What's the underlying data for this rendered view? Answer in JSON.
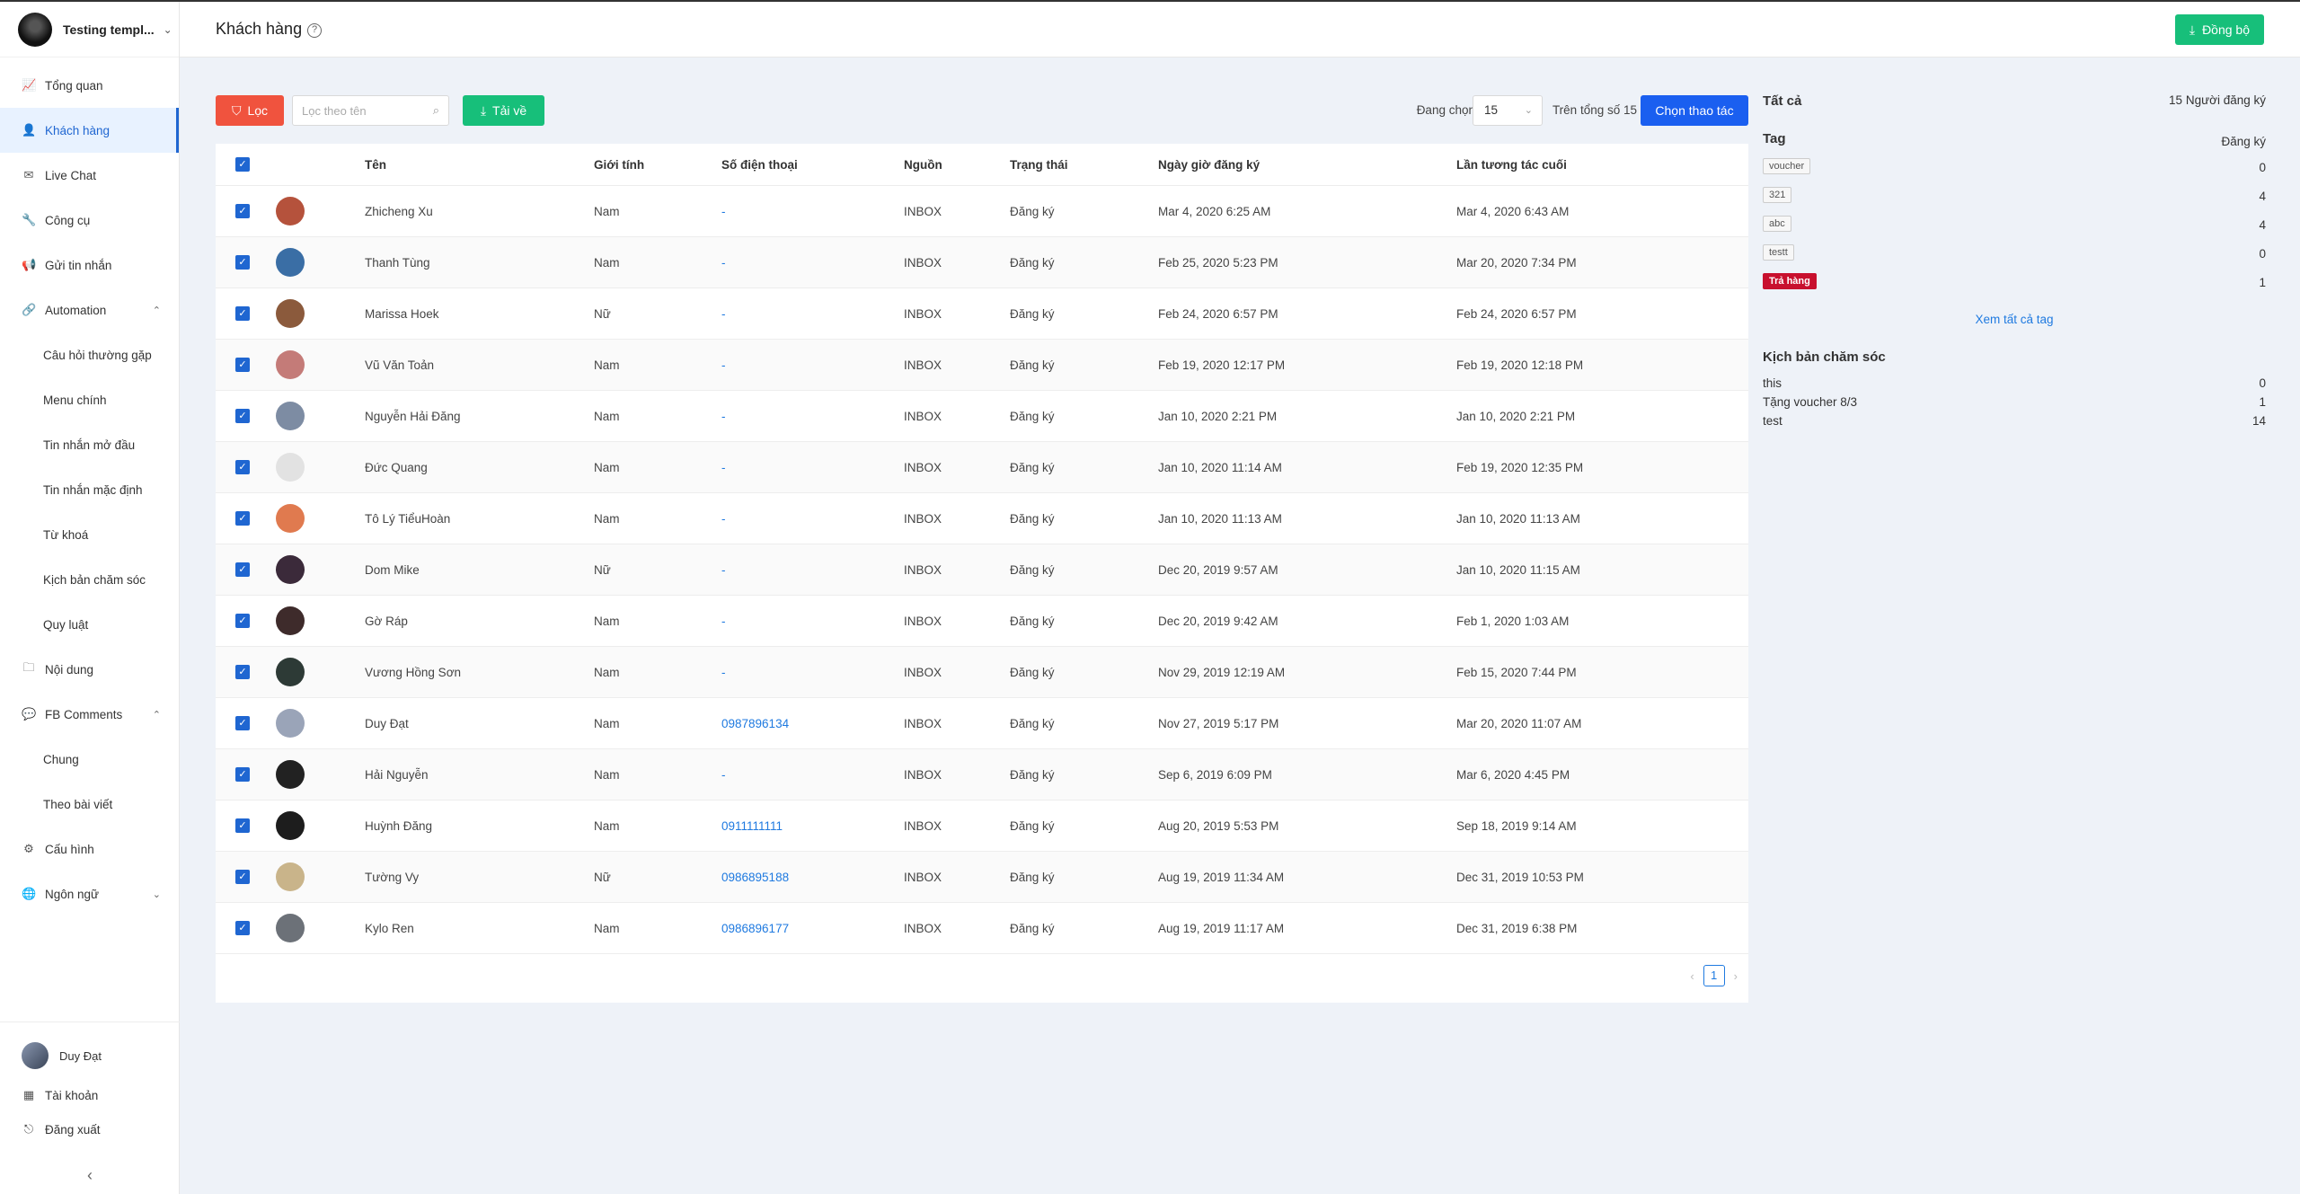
{
  "brand": {
    "name": "Testing templ..."
  },
  "sidebar": {
    "items": [
      {
        "label": "Tổng quan",
        "icon": "chart-icon",
        "glyph": "📈",
        "sub": false,
        "active": false
      },
      {
        "label": "Khách hàng",
        "icon": "user-icon",
        "glyph": "👤",
        "sub": false,
        "active": true
      },
      {
        "label": "Live Chat",
        "icon": "mail-icon",
        "glyph": "✉",
        "sub": false,
        "active": false
      },
      {
        "label": "Công cụ",
        "icon": "tool-icon",
        "glyph": "🔧",
        "sub": false,
        "active": false
      },
      {
        "label": "Gửi tin nhắn",
        "icon": "megaphone-icon",
        "glyph": "📢",
        "sub": false,
        "active": false
      },
      {
        "label": "Automation",
        "icon": "link-icon",
        "glyph": "🔗",
        "sub": false,
        "active": false,
        "arrow": "⌃"
      },
      {
        "label": "Câu hỏi thường gặp",
        "sub": true
      },
      {
        "label": "Menu chính",
        "sub": true
      },
      {
        "label": "Tin nhắn mở đầu",
        "sub": true
      },
      {
        "label": "Tin nhắn mặc định",
        "sub": true
      },
      {
        "label": "Từ khoá",
        "sub": true
      },
      {
        "label": "Kịch bản chăm sóc",
        "sub": true
      },
      {
        "label": "Quy luật",
        "sub": true
      },
      {
        "label": "Nội dung",
        "icon": "folder-icon",
        "glyph": "🗀",
        "sub": false
      },
      {
        "label": "FB Comments",
        "icon": "comment-icon",
        "glyph": "💬",
        "sub": false,
        "arrow": "⌃"
      },
      {
        "label": "Chung",
        "sub": true
      },
      {
        "label": "Theo bài viết",
        "sub": true
      },
      {
        "label": "Cấu hình",
        "icon": "gear-icon",
        "glyph": "⚙",
        "sub": false
      },
      {
        "label": "Ngôn ngữ",
        "icon": "globe-icon",
        "glyph": "🌐",
        "sub": false,
        "arrow": "⌄"
      }
    ],
    "user": "Duy Đạt",
    "account": "Tài khoản",
    "logout": "Đăng xuất"
  },
  "header": {
    "title": "Khách hàng",
    "sync": "Đồng bộ"
  },
  "toolbar": {
    "filter": "Lọc",
    "search_placeholder": "Lọc theo tên",
    "download": "Tải về",
    "selecting_label": "Đang chọn",
    "selecting_value": "15",
    "total_label": "Trên tổng số 15",
    "action": "Chọn thao tác"
  },
  "table": {
    "columns": [
      "Tên",
      "Giới tính",
      "Số điện thoại",
      "Nguồn",
      "Trạng thái",
      "Ngày giờ đăng ký",
      "Lần tương tác cuối"
    ],
    "rows": [
      {
        "name": "Zhicheng Xu",
        "gender": "Nam",
        "phone": "-",
        "source": "INBOX",
        "status": "Đăng ký",
        "registered": "Mar 4, 2020 6:25 AM",
        "last": "Mar 4, 2020 6:43 AM",
        "avatar": "#b5523c"
      },
      {
        "name": "Thanh Tùng",
        "gender": "Nam",
        "phone": "-",
        "source": "INBOX",
        "status": "Đăng ký",
        "registered": "Feb 25, 2020 5:23 PM",
        "last": "Mar 20, 2020 7:34 PM",
        "avatar": "#3a6ea5"
      },
      {
        "name": "Marissa Hoek",
        "gender": "Nữ",
        "phone": "-",
        "source": "INBOX",
        "status": "Đăng ký",
        "registered": "Feb 24, 2020 6:57 PM",
        "last": "Feb 24, 2020 6:57 PM",
        "avatar": "#8b5a3c"
      },
      {
        "name": "Vũ Văn Toản",
        "gender": "Nam",
        "phone": "-",
        "source": "INBOX",
        "status": "Đăng ký",
        "registered": "Feb 19, 2020 12:17 PM",
        "last": "Feb 19, 2020 12:18 PM",
        "avatar": "#c47b78"
      },
      {
        "name": "Nguyễn Hải Đăng",
        "gender": "Nam",
        "phone": "-",
        "source": "INBOX",
        "status": "Đăng ký",
        "registered": "Jan 10, 2020 2:21 PM",
        "last": "Jan 10, 2020 2:21 PM",
        "avatar": "#7d8ca3"
      },
      {
        "name": "Đức Quang",
        "gender": "Nam",
        "phone": "-",
        "source": "INBOX",
        "status": "Đăng ký",
        "registered": "Jan 10, 2020 11:14 AM",
        "last": "Feb 19, 2020 12:35 PM",
        "avatar": "#e2e2e2"
      },
      {
        "name": "Tô Lý TiểuHoàn",
        "gender": "Nam",
        "phone": "-",
        "source": "INBOX",
        "status": "Đăng ký",
        "registered": "Jan 10, 2020 11:13 AM",
        "last": "Jan 10, 2020 11:13 AM",
        "avatar": "#e07a4f"
      },
      {
        "name": "Dom Mike",
        "gender": "Nữ",
        "phone": "-",
        "source": "INBOX",
        "status": "Đăng ký",
        "registered": "Dec 20, 2019 9:57 AM",
        "last": "Jan 10, 2020 11:15 AM",
        "avatar": "#3b2a3a"
      },
      {
        "name": "Gờ Ráp",
        "gender": "Nam",
        "phone": "-",
        "source": "INBOX",
        "status": "Đăng ký",
        "registered": "Dec 20, 2019 9:42 AM",
        "last": "Feb 1, 2020 1:03 AM",
        "avatar": "#3e2b2b"
      },
      {
        "name": "Vương Hồng Sơn",
        "gender": "Nam",
        "phone": "-",
        "source": "INBOX",
        "status": "Đăng ký",
        "registered": "Nov 29, 2019 12:19 AM",
        "last": "Feb 15, 2020 7:44 PM",
        "avatar": "#2d3a36"
      },
      {
        "name": "Duy Đạt",
        "gender": "Nam",
        "phone": "0987896134",
        "source": "INBOX",
        "status": "Đăng ký",
        "registered": "Nov 27, 2019 5:17 PM",
        "last": "Mar 20, 2020 11:07 AM",
        "avatar": "#9aa4b8"
      },
      {
        "name": "Hải Nguyễn",
        "gender": "Nam",
        "phone": "-",
        "source": "INBOX",
        "status": "Đăng ký",
        "registered": "Sep 6, 2019 6:09 PM",
        "last": "Mar 6, 2020 4:45 PM",
        "avatar": "#222222"
      },
      {
        "name": "Huỳnh Đăng",
        "gender": "Nam",
        "phone": "0911111111",
        "source": "INBOX",
        "status": "Đăng ký",
        "registered": "Aug 20, 2019 5:53 PM",
        "last": "Sep 18, 2019 9:14 AM",
        "avatar": "#1d1d1d"
      },
      {
        "name": "Tường Vy",
        "gender": "Nữ",
        "phone": "0986895188",
        "source": "INBOX",
        "status": "Đăng ký",
        "registered": "Aug 19, 2019 11:34 AM",
        "last": "Dec 31, 2019 10:53 PM",
        "avatar": "#c9b48a"
      },
      {
        "name": "Kylo Ren",
        "gender": "Nam",
        "phone": "0986896177",
        "source": "INBOX",
        "status": "Đăng ký",
        "registered": "Aug 19, 2019 11:17 AM",
        "last": "Dec 31, 2019 6:38 PM",
        "avatar": "#6c7178"
      }
    ],
    "page": "1"
  },
  "right_panel": {
    "all_label": "Tất cả",
    "all_count": "15 Người đăng ký",
    "tag_label": "Tag",
    "tag_col": "Đăng ký",
    "tags": [
      {
        "name": "voucher",
        "count": "0",
        "red": false
      },
      {
        "name": "321",
        "count": "4",
        "red": false
      },
      {
        "name": "abc",
        "count": "4",
        "red": false
      },
      {
        "name": "testt",
        "count": "0",
        "red": false
      },
      {
        "name": "Trả hàng",
        "count": "1",
        "red": true
      }
    ],
    "see_all": "Xem tất cả tag",
    "scenario_label": "Kịch bản chăm sóc",
    "scenarios": [
      {
        "name": "this",
        "count": "0"
      },
      {
        "name": "Tặng voucher 8/3",
        "count": "1"
      },
      {
        "name": "test",
        "count": "14"
      }
    ]
  }
}
